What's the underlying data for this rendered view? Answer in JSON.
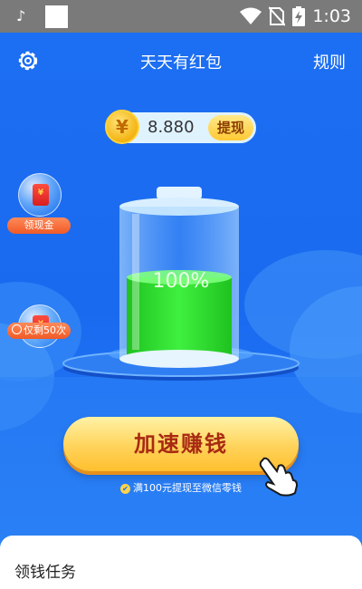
{
  "status_bar": {
    "time": "1:03",
    "icons": [
      "tiktok-icon",
      "notification-square",
      "wifi-icon",
      "no-sim-icon",
      "battery-charging-icon"
    ]
  },
  "header": {
    "title": "天天有红包",
    "rules": "规则",
    "settings_icon": "gear-icon"
  },
  "balance": {
    "coin_symbol": "¥",
    "value": "8.880",
    "withdraw": "提现"
  },
  "bubbles": [
    {
      "label": "领现金",
      "icon": "red-envelope-icon"
    },
    {
      "label": "仅剩50次",
      "icon": "red-envelope-icon",
      "badge_icon": "clock-icon"
    }
  ],
  "battery": {
    "percent_text": "100%",
    "level": 1.0,
    "fill_color": "#2ee52e"
  },
  "action": {
    "speed_button": "加速赚钱",
    "tip": "满100元提现至微信零钱"
  },
  "tasks": {
    "title": "领钱任务"
  },
  "colors": {
    "background": "#1a6ff0",
    "accent_yellow": "#ffd35a",
    "button_text": "#a82a12"
  }
}
